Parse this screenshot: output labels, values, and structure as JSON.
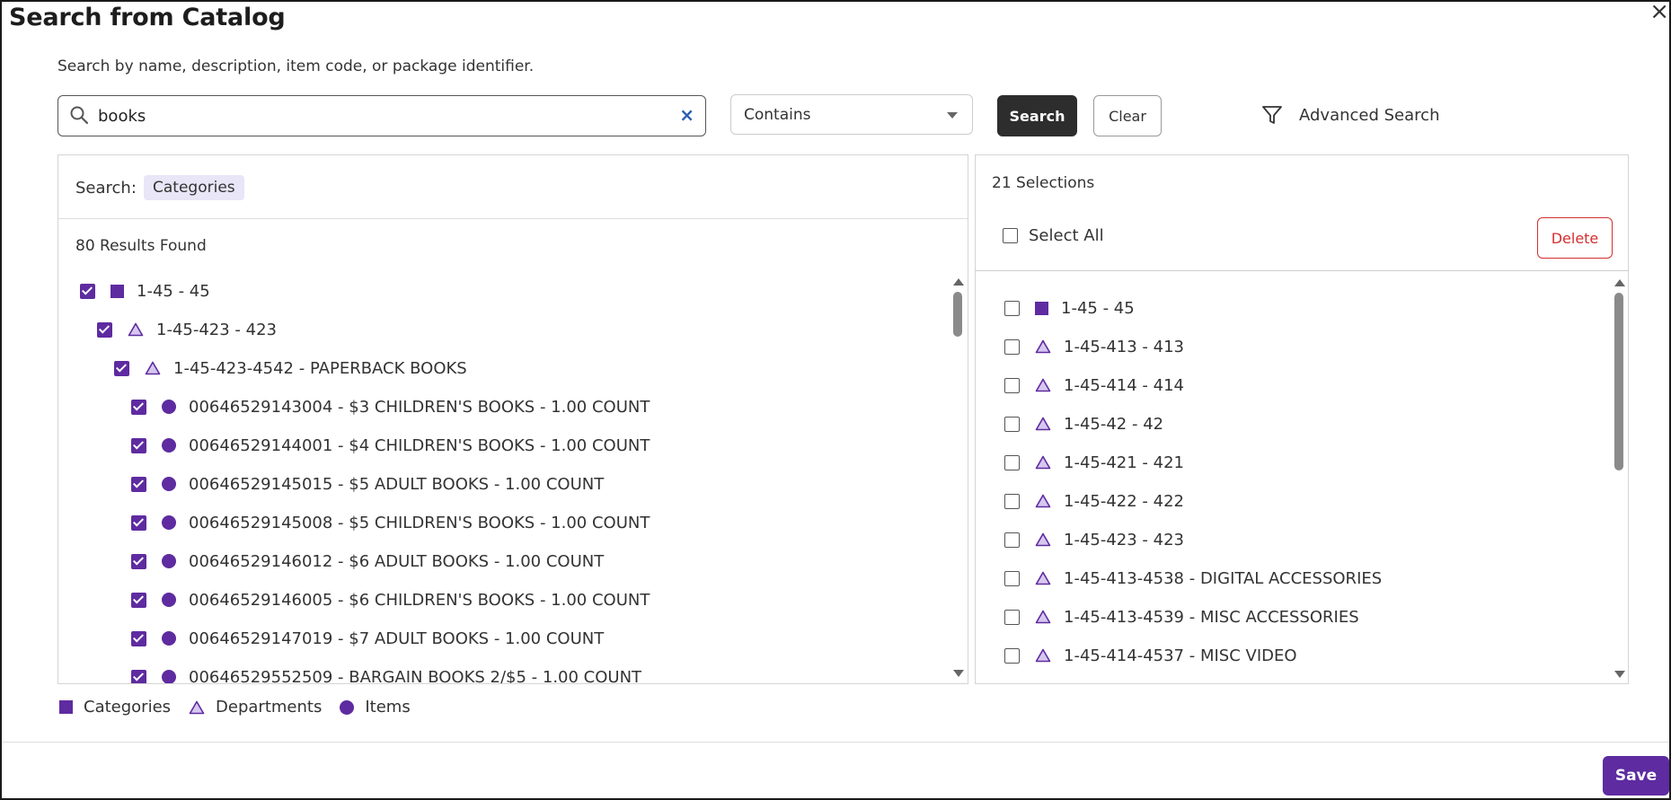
{
  "dialog": {
    "title": "Search from Catalog",
    "subtitle": "Search by name, description, item code, or package identifier."
  },
  "search": {
    "value": "books",
    "match_mode": "Contains",
    "search_button": "Search",
    "clear_button": "Clear",
    "advanced_label": "Advanced Search"
  },
  "results": {
    "search_label": "Search:",
    "filter_chip": "Categories",
    "count_text": "80 Results Found",
    "rows": [
      {
        "label": "1-45 - 45",
        "type": "category",
        "level": 0,
        "checked": true
      },
      {
        "label": "1-45-423 - 423",
        "type": "department",
        "level": 1,
        "checked": true
      },
      {
        "label": "1-45-423-4542 - PAPERBACK BOOKS",
        "type": "department",
        "level": 2,
        "checked": true
      },
      {
        "label": "00646529143004 - $3 CHILDREN'S BOOKS - 1.00 COUNT",
        "type": "item",
        "level": 3,
        "checked": true
      },
      {
        "label": "00646529144001 - $4 CHILDREN'S BOOKS - 1.00 COUNT",
        "type": "item",
        "level": 3,
        "checked": true
      },
      {
        "label": "00646529145015 - $5 ADULT BOOKS - 1.00 COUNT",
        "type": "item",
        "level": 3,
        "checked": true
      },
      {
        "label": "00646529145008 - $5 CHILDREN'S BOOKS - 1.00 COUNT",
        "type": "item",
        "level": 3,
        "checked": true
      },
      {
        "label": "00646529146012 - $6 ADULT BOOKS - 1.00 COUNT",
        "type": "item",
        "level": 3,
        "checked": true
      },
      {
        "label": "00646529146005 - $6 CHILDREN'S BOOKS - 1.00 COUNT",
        "type": "item",
        "level": 3,
        "checked": true
      },
      {
        "label": "00646529147019 - $7 ADULT BOOKS - 1.00 COUNT",
        "type": "item",
        "level": 3,
        "checked": true
      },
      {
        "label": "00646529552509 - BARGAIN BOOKS 2/$5 - 1.00 COUNT",
        "type": "item",
        "level": 3,
        "checked": true
      }
    ]
  },
  "selections": {
    "count_text": "21 Selections",
    "select_all_label": "Select All",
    "delete_button": "Delete",
    "rows": [
      {
        "label": "1-45 - 45",
        "type": "category",
        "checked": false
      },
      {
        "label": "1-45-413 - 413",
        "type": "department",
        "checked": false
      },
      {
        "label": "1-45-414 - 414",
        "type": "department",
        "checked": false
      },
      {
        "label": "1-45-42 - 42",
        "type": "department",
        "checked": false
      },
      {
        "label": "1-45-421 - 421",
        "type": "department",
        "checked": false
      },
      {
        "label": "1-45-422 - 422",
        "type": "department",
        "checked": false
      },
      {
        "label": "1-45-423 - 423",
        "type": "department",
        "checked": false
      },
      {
        "label": "1-45-413-4538 - DIGITAL ACCESSORIES",
        "type": "department",
        "checked": false
      },
      {
        "label": "1-45-413-4539 - MISC ACCESSORIES",
        "type": "department",
        "checked": false
      },
      {
        "label": "1-45-414-4537 - MISC VIDEO",
        "type": "department",
        "checked": false
      }
    ]
  },
  "legend": [
    {
      "label": "Categories",
      "icon": "square-icon"
    },
    {
      "label": "Departments",
      "icon": "triangle-icon"
    },
    {
      "label": "Items",
      "icon": "circle-icon"
    }
  ],
  "footer": {
    "save_button": "Save"
  },
  "colors": {
    "accent": "#5e2ba0",
    "danger": "#d32f2f",
    "dark_button": "#2d2d2d",
    "chip_bg": "#e8e6f7",
    "clear_icon": "#2a5fb5"
  }
}
